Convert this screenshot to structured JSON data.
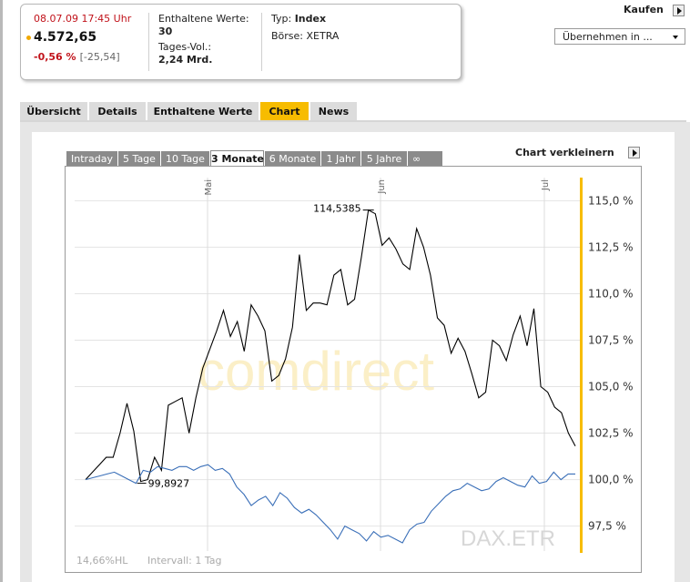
{
  "quote": {
    "date_time": "08.07.09  17:45 Uhr",
    "price": "4.572,65",
    "change_pct": "-0,56 %",
    "change_abs": "[-25,54]",
    "constituents_label": "Enthaltene Werte:",
    "constituents_value": "30",
    "volume_label": "Tages-Vol.:",
    "volume_value": "2,24 Mrd.",
    "type_label": "Typ:",
    "type_value": "Index",
    "exchange_label": "Börse:",
    "exchange_value": "XETRA"
  },
  "actions": {
    "buy_label": "Kaufen",
    "select_value": "Übernehmen in ..."
  },
  "tabs": [
    "Übersicht",
    "Details",
    "Enthaltene Werte",
    "Chart",
    "News"
  ],
  "active_tab": "Chart",
  "period_tabs": [
    "Intraday",
    "5 Tage",
    "10 Tage",
    "3 Monate",
    "6 Monate",
    "1 Jahr",
    "5 Jahre",
    "∞"
  ],
  "active_period": "3 Monate",
  "chart_toggle_label": "Chart verkleinern",
  "watermark": "comdirect",
  "chart_footer": {
    "left": "14,66%HL",
    "interval": "Intervall: 1 Tag",
    "symbol": "DAX.ETR"
  },
  "colors": {
    "accent": "#f7bc00",
    "negative": "#c1121a",
    "series_dax": "#000000",
    "series_benchmark": "#3a6fb8"
  },
  "chart_data": {
    "type": "line",
    "x_labels": [
      "Mai",
      "Jun",
      "Jul"
    ],
    "y_ticks": [
      "115,0 %",
      "112,5 %",
      "110,0 %",
      "107,5 %",
      "105,0 %",
      "102,5 %",
      "100,0 %",
      "97,5 %"
    ],
    "ylim": [
      96.5,
      116.0
    ],
    "annotations": [
      {
        "text": "114,5385",
        "index": 41
      },
      {
        "text": "99,8927",
        "index": 8
      }
    ],
    "series": [
      {
        "values": [
          100.0,
          100.4,
          100.8,
          101.2,
          101.2,
          102.5,
          104.1,
          102.6,
          99.9,
          100.0,
          101.2,
          100.5,
          104.0,
          104.2,
          104.4,
          102.5,
          104.4,
          106.0,
          107.0,
          108.0,
          109.1,
          107.7,
          108.5,
          106.9,
          109.4,
          108.8,
          108.0,
          105.3,
          105.6,
          106.5,
          108.2,
          112.1,
          109.1,
          109.5,
          109.5,
          109.4,
          111.0,
          111.3,
          109.4,
          109.7,
          112.0,
          114.5,
          114.3,
          112.6,
          113.0,
          112.4,
          111.6,
          111.3,
          113.5,
          112.5,
          111.0,
          108.7,
          108.3,
          106.8,
          107.6,
          106.9,
          105.7,
          104.4,
          104.7,
          107.5,
          107.2,
          106.4,
          107.8,
          108.8,
          107.2,
          109.2,
          105.0,
          104.7,
          103.9,
          103.6,
          102.5,
          101.8
        ]
      },
      {
        "values": [
          100.0,
          100.1,
          100.2,
          100.3,
          100.4,
          100.2,
          100.0,
          99.8,
          100.5,
          100.4,
          100.7,
          100.6,
          100.5,
          100.7,
          100.7,
          100.5,
          100.7,
          100.8,
          100.5,
          100.6,
          100.3,
          99.6,
          99.2,
          98.6,
          98.9,
          99.1,
          98.6,
          99.3,
          99.0,
          98.5,
          98.2,
          98.4,
          98.1,
          97.7,
          97.3,
          96.8,
          97.5,
          97.3,
          97.1,
          96.7,
          97.2,
          96.9,
          97.0,
          96.8,
          96.6,
          97.3,
          97.6,
          97.7,
          98.3,
          98.7,
          99.1,
          99.4,
          99.5,
          99.8,
          99.6,
          99.4,
          99.5,
          99.9,
          100.1,
          99.9,
          99.7,
          99.6,
          100.2,
          99.8,
          99.9,
          100.4,
          100.0,
          100.3,
          100.3
        ]
      }
    ]
  }
}
